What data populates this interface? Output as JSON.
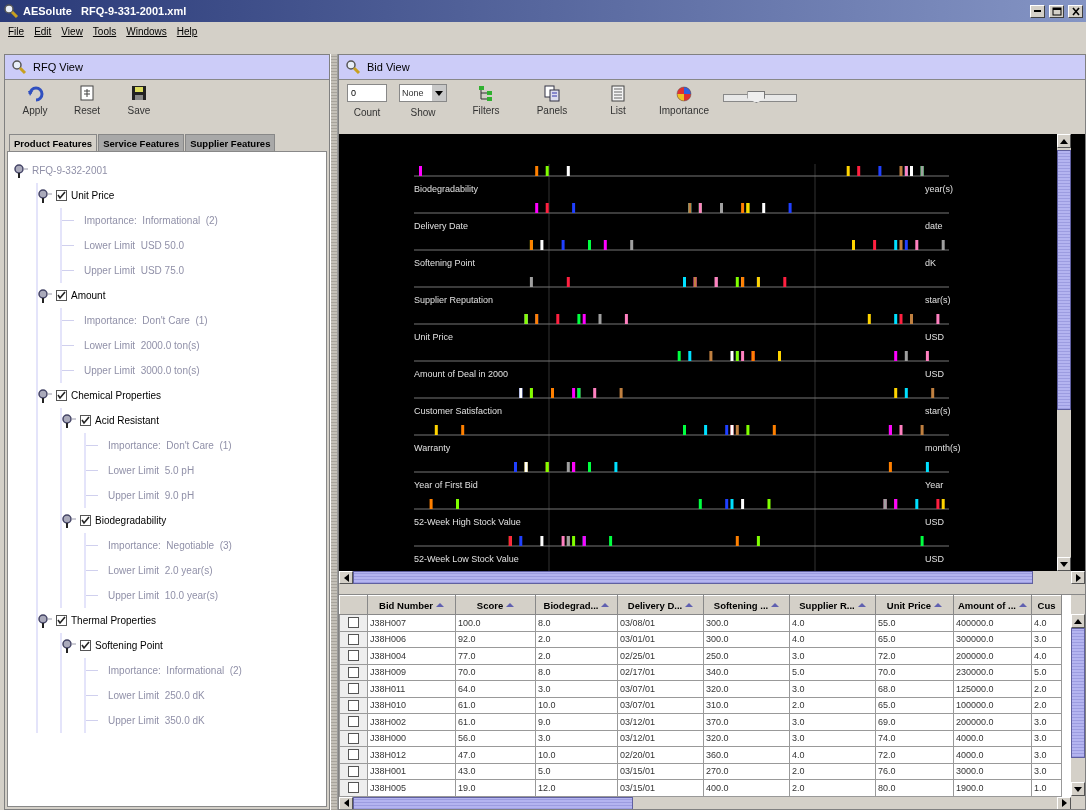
{
  "window": {
    "title": "AESolute   RFQ-9-331-2001.xml"
  },
  "menu": [
    "File",
    "Edit",
    "View",
    "Tools",
    "Windows",
    "Help"
  ],
  "rfq_view": {
    "title": "RFQ View",
    "toolbar": [
      {
        "label": "Apply",
        "kind": "apply"
      },
      {
        "label": "Reset",
        "kind": "reset"
      },
      {
        "label": "Save",
        "kind": "save"
      }
    ],
    "tabs": [
      {
        "label": "Product Features",
        "selected": true
      },
      {
        "label": "Service Features",
        "selected": false
      },
      {
        "label": "Supplier Features",
        "selected": false
      }
    ],
    "tree": {
      "label": "RFQ-9-332-2001",
      "children": [
        {
          "label": "Unit Price",
          "checked": true,
          "children": [
            {
              "label": "Importance:  Informational  (2)"
            },
            {
              "label": "Lower Limit  USD 50.0"
            },
            {
              "label": "Upper Limit  USD 75.0"
            }
          ]
        },
        {
          "label": "Amount",
          "checked": true,
          "children": [
            {
              "label": "Importance:  Don't Care  (1)"
            },
            {
              "label": "Lower Limit  2000.0 ton(s)"
            },
            {
              "label": "Upper Limit  3000.0 ton(s)"
            }
          ]
        },
        {
          "label": "Chemical Properties",
          "checked": true,
          "children": [
            {
              "label": "Acid Resistant",
              "checked": true,
              "children": [
                {
                  "label": "Importance:  Don't Care  (1)"
                },
                {
                  "label": "Lower Limit  5.0 pH"
                },
                {
                  "label": "Upper Limit  9.0 pH"
                }
              ]
            },
            {
              "label": "Biodegradability",
              "checked": true,
              "children": [
                {
                  "label": "Importance:  Negotiable  (3)"
                },
                {
                  "label": "Lower Limit  2.0 year(s)"
                },
                {
                  "label": "Upper Limit  10.0 year(s)"
                }
              ]
            }
          ]
        },
        {
          "label": "Thermal Properties",
          "checked": true,
          "children": [
            {
              "label": "Softening Point",
              "checked": true,
              "children": [
                {
                  "label": "Importance:  Informational  (2)"
                },
                {
                  "label": "Lower Limit  250.0 dK"
                },
                {
                  "label": "Upper Limit  350.0 dK"
                }
              ]
            }
          ]
        }
      ]
    }
  },
  "bid_view": {
    "title": "Bid View",
    "count": {
      "label": "Count",
      "value": "0"
    },
    "show": {
      "label": "Show",
      "value": "None"
    },
    "toolbar": [
      {
        "label": "Filters",
        "kind": "filters"
      },
      {
        "label": "Panels",
        "kind": "panels"
      },
      {
        "label": "List",
        "kind": "list"
      },
      {
        "label": "Importance",
        "kind": "importance"
      }
    ],
    "slider": {
      "level": 0.45
    },
    "strips": [
      {
        "label": "Biodegradability",
        "unit": "year(s)"
      },
      {
        "label": "Delivery Date",
        "unit": "date"
      },
      {
        "label": "Softening Point",
        "unit": "dK"
      },
      {
        "label": "Supplier Reputation",
        "unit": "star(s)"
      },
      {
        "label": "Unit Price",
        "unit": "USD"
      },
      {
        "label": "Amount of Deal in 2000",
        "unit": "USD"
      },
      {
        "label": "Customer Satisfaction",
        "unit": "star(s)"
      },
      {
        "label": "Warranty",
        "unit": "month(s)"
      },
      {
        "label": "Year of First Bid",
        "unit": "Year"
      },
      {
        "label": "52-Week High Stock Value",
        "unit": "USD"
      },
      {
        "label": "52-Week Low Stock Value",
        "unit": "USD"
      }
    ],
    "table": {
      "columns": [
        "Bid Number",
        "Score",
        "Biodegrad...",
        "Delivery D...",
        "Softening ...",
        "Supplier R...",
        "Unit Price",
        "Amount of ...",
        "Cus"
      ],
      "rows": [
        {
          "checked": false,
          "cells": [
            "J38H007",
            "100.0",
            "8.0",
            "03/08/01",
            "300.0",
            "4.0",
            "55.0",
            "400000.0",
            "4.0"
          ]
        },
        {
          "checked": false,
          "cells": [
            "J38H006",
            "92.0",
            "2.0",
            "03/01/01",
            "300.0",
            "4.0",
            "65.0",
            "300000.0",
            "3.0"
          ]
        },
        {
          "checked": false,
          "cells": [
            "J38H004",
            "77.0",
            "2.0",
            "02/25/01",
            "250.0",
            "3.0",
            "72.0",
            "200000.0",
            "4.0"
          ]
        },
        {
          "checked": false,
          "cells": [
            "J38H009",
            "70.0",
            "8.0",
            "02/17/01",
            "340.0",
            "5.0",
            "70.0",
            "230000.0",
            "5.0"
          ]
        },
        {
          "checked": false,
          "cells": [
            "J38H011",
            "64.0",
            "3.0",
            "03/07/01",
            "320.0",
            "3.0",
            "68.0",
            "125000.0",
            "2.0"
          ]
        },
        {
          "checked": false,
          "cells": [
            "J38H010",
            "61.0",
            "10.0",
            "03/07/01",
            "310.0",
            "2.0",
            "65.0",
            "100000.0",
            "2.0"
          ]
        },
        {
          "checked": false,
          "cells": [
            "J38H002",
            "61.0",
            "9.0",
            "03/12/01",
            "370.0",
            "3.0",
            "69.0",
            "200000.0",
            "3.0"
          ]
        },
        {
          "checked": false,
          "cells": [
            "J38H000",
            "56.0",
            "3.0",
            "03/12/01",
            "320.0",
            "3.0",
            "74.0",
            "4000.0",
            "3.0"
          ]
        },
        {
          "checked": false,
          "cells": [
            "J38H012",
            "47.0",
            "10.0",
            "02/20/01",
            "360.0",
            "4.0",
            "72.0",
            "4000.0",
            "3.0"
          ]
        },
        {
          "checked": false,
          "cells": [
            "J38H001",
            "43.0",
            "5.0",
            "03/15/01",
            "270.0",
            "2.0",
            "76.0",
            "3000.0",
            "3.0"
          ]
        },
        {
          "checked": false,
          "cells": [
            "J38H005",
            "19.0",
            "12.0",
            "03/15/01",
            "400.0",
            "2.0",
            "80.0",
            "1900.0",
            "1.0"
          ]
        }
      ]
    }
  }
}
